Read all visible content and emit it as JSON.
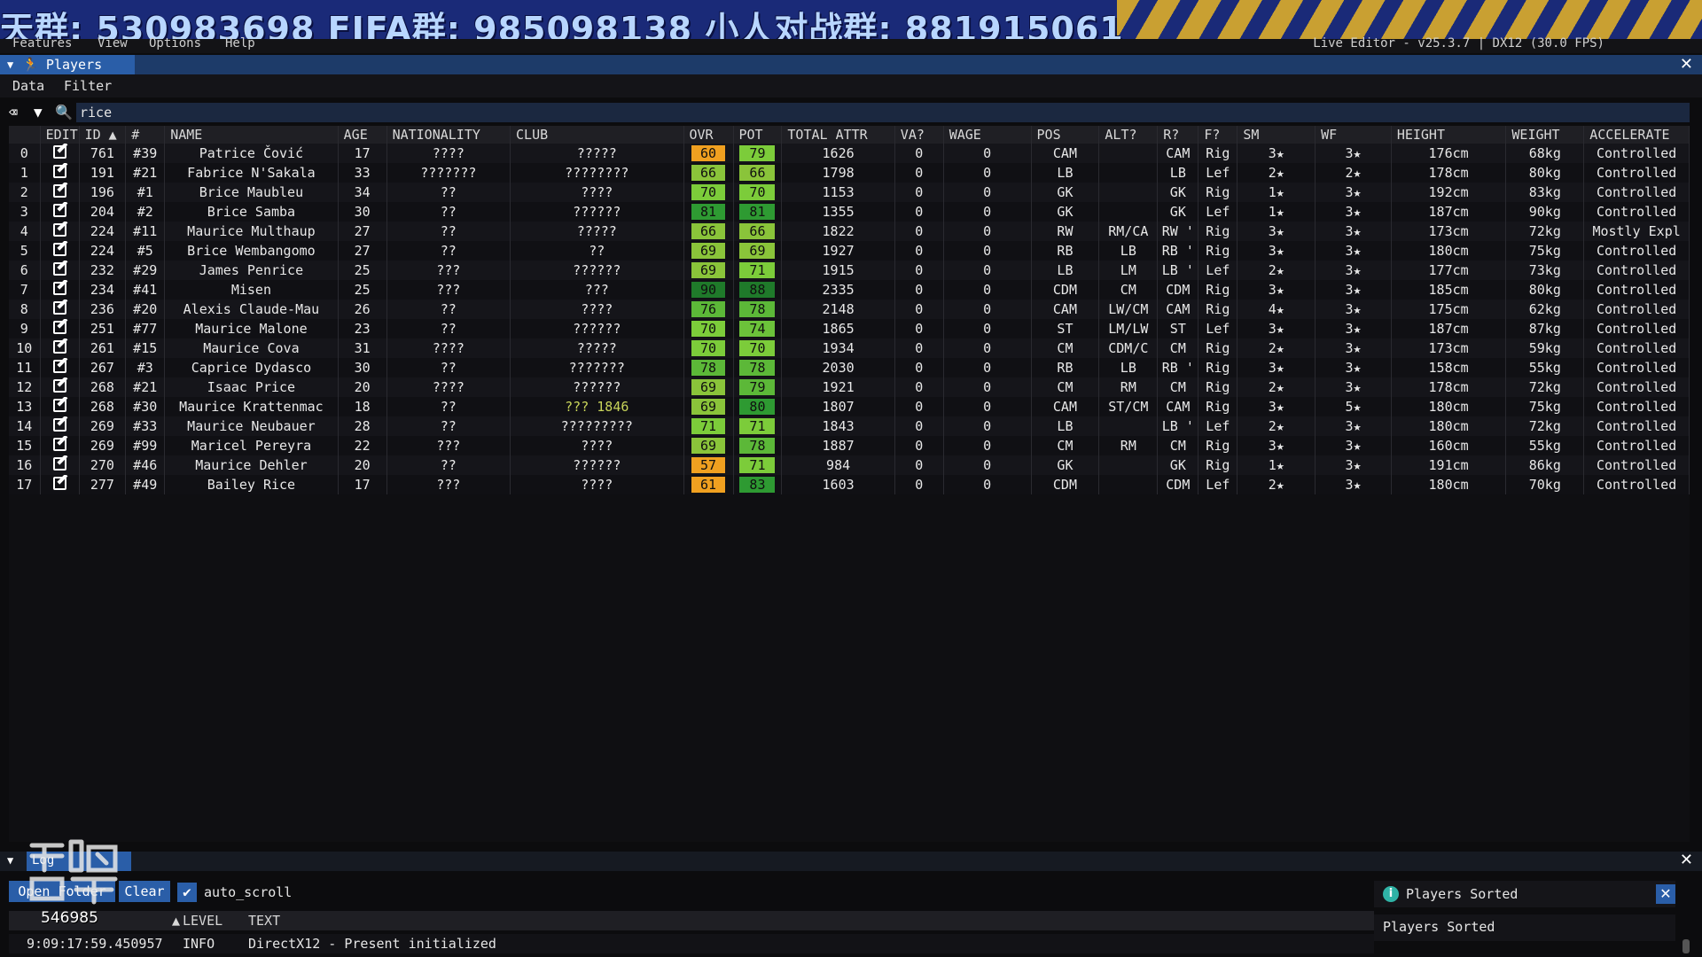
{
  "banner": {
    "text": "天群: 530983698   FIFA群: 985098138   小人对战群: 881915061"
  },
  "menubar": {
    "items": [
      "Features",
      "View",
      "Options",
      "Help"
    ],
    "editor_title": "Live Editor - v25.3.7 | DX12 (30.0 FPS)"
  },
  "players_window": {
    "tab_label": "Players",
    "menu": [
      "Data",
      "Filter"
    ],
    "search_value": "rice"
  },
  "table": {
    "columns": [
      "",
      "EDIT",
      "ID ▲",
      "#",
      "NAME",
      "AGE",
      "NATIONALITY",
      "CLUB",
      "OVR",
      "POT",
      "TOTAL ATTR",
      "VA?",
      "WAGE",
      "POS",
      "ALT?",
      "R?",
      "F?",
      "SM",
      "WF",
      "HEIGHT",
      "WEIGHT",
      "ACCELERATE"
    ],
    "rows": [
      {
        "idx": "0",
        "id": "761",
        "num": "#39",
        "name": "Patrice Čović",
        "age": "17",
        "nat": "????",
        "club": "?????",
        "ovr": "60",
        "pot": "79",
        "total": "1626",
        "va": "0",
        "wage": "0",
        "pos": "CAM",
        "alt": "",
        "r": "CAM",
        "f": "Rig",
        "sm": "3★",
        "wf": "3★",
        "height": "176cm",
        "weight": "68kg",
        "acc": "Controlled",
        "ovr_color": "#f0a020",
        "pot_color": "#7ccc3a"
      },
      {
        "idx": "1",
        "id": "191",
        "num": "#21",
        "name": "Fabrice N'Sakala",
        "age": "33",
        "nat": "???????",
        "club": "????????",
        "ovr": "66",
        "pot": "66",
        "total": "1798",
        "va": "0",
        "wage": "0",
        "pos": "LB",
        "alt": "",
        "r": "LB",
        "f": "Lef",
        "sm": "2★",
        "wf": "2★",
        "height": "178cm",
        "weight": "80kg",
        "acc": "Controlled",
        "ovr_color": "#8ac43a",
        "pot_color": "#8ac43a"
      },
      {
        "idx": "2",
        "id": "196",
        "num": "#1",
        "name": "Brice Maubleu",
        "age": "34",
        "nat": "??",
        "club": "????",
        "ovr": "70",
        "pot": "70",
        "total": "1153",
        "va": "0",
        "wage": "0",
        "pos": "GK",
        "alt": "",
        "r": "GK",
        "f": "Rig",
        "sm": "1★",
        "wf": "3★",
        "height": "192cm",
        "weight": "83kg",
        "acc": "Controlled",
        "ovr_color": "#7ccc3a",
        "pot_color": "#7ccc3a"
      },
      {
        "idx": "3",
        "id": "204",
        "num": "#2",
        "name": "Brice Samba",
        "age": "30",
        "nat": "??",
        "club": "??????",
        "ovr": "81",
        "pot": "81",
        "total": "1355",
        "va": "0",
        "wage": "0",
        "pos": "GK",
        "alt": "",
        "r": "GK",
        "f": "Lef",
        "sm": "1★",
        "wf": "3★",
        "height": "187cm",
        "weight": "90kg",
        "acc": "Controlled",
        "ovr_color": "#2e9a32",
        "pot_color": "#2e9a32"
      },
      {
        "idx": "4",
        "id": "224",
        "num": "#11",
        "name": "Maurice Multhaup",
        "age": "27",
        "nat": "??",
        "club": "?????",
        "ovr": "66",
        "pot": "66",
        "total": "1822",
        "va": "0",
        "wage": "0",
        "pos": "RW",
        "alt": "RM/CA",
        "r": "RW '",
        "f": "Rig",
        "sm": "3★",
        "wf": "3★",
        "height": "173cm",
        "weight": "72kg",
        "acc": "Mostly Expl",
        "ovr_color": "#8ac43a",
        "pot_color": "#8ac43a"
      },
      {
        "idx": "5",
        "id": "224",
        "num": "#5",
        "name": "Brice Wembangomo",
        "age": "27",
        "nat": "??",
        "club": "??",
        "ovr": "69",
        "pot": "69",
        "total": "1927",
        "va": "0",
        "wage": "0",
        "pos": "RB",
        "alt": "LB",
        "r": "RB '",
        "f": "Rig",
        "sm": "3★",
        "wf": "3★",
        "height": "180cm",
        "weight": "75kg",
        "acc": "Controlled",
        "ovr_color": "#8ac43a",
        "pot_color": "#8ac43a"
      },
      {
        "idx": "6",
        "id": "232",
        "num": "#29",
        "name": "James Penrice",
        "age": "25",
        "nat": "???",
        "club": "??????",
        "ovr": "69",
        "pot": "71",
        "total": "1915",
        "va": "0",
        "wage": "0",
        "pos": "LB",
        "alt": "LM",
        "r": "LB '",
        "f": "Lef",
        "sm": "2★",
        "wf": "3★",
        "height": "177cm",
        "weight": "73kg",
        "acc": "Controlled",
        "ovr_color": "#8ac43a",
        "pot_color": "#7ccc3a"
      },
      {
        "idx": "7",
        "id": "234",
        "num": "#41",
        "name": "Misen",
        "age": "25",
        "nat": "???",
        "club": "???",
        "ovr": "90",
        "pot": "88",
        "total": "2335",
        "va": "0",
        "wage": "0",
        "pos": "CDM",
        "alt": "CM",
        "r": "CDM",
        "f": "Rig",
        "sm": "3★",
        "wf": "3★",
        "height": "185cm",
        "weight": "80kg",
        "acc": "Controlled",
        "ovr_color": "#1f7a2a",
        "pot_color": "#1f7a2a"
      },
      {
        "idx": "8",
        "id": "236",
        "num": "#20",
        "name": "Alexis Claude-Mau",
        "age": "26",
        "nat": "??",
        "club": "????",
        "ovr": "76",
        "pot": "78",
        "total": "2148",
        "va": "0",
        "wage": "0",
        "pos": "CAM",
        "alt": "LW/CM",
        "r": "CAM",
        "f": "Rig",
        "sm": "4★",
        "wf": "3★",
        "height": "175cm",
        "weight": "62kg",
        "acc": "Controlled",
        "ovr_color": "#5cb838",
        "pot_color": "#5cb838"
      },
      {
        "idx": "9",
        "id": "251",
        "num": "#77",
        "name": "Maurice Malone",
        "age": "23",
        "nat": "??",
        "club": "??????",
        "ovr": "70",
        "pot": "74",
        "total": "1865",
        "va": "0",
        "wage": "0",
        "pos": "ST",
        "alt": "LM/LW",
        "r": "ST",
        "f": "Lef",
        "sm": "3★",
        "wf": "3★",
        "height": "187cm",
        "weight": "87kg",
        "acc": "Controlled",
        "ovr_color": "#7ccc3a",
        "pot_color": "#6cc23a"
      },
      {
        "idx": "10",
        "id": "261",
        "num": "#15",
        "name": "Maurice Cova",
        "age": "31",
        "nat": "????",
        "club": "?????",
        "ovr": "70",
        "pot": "70",
        "total": "1934",
        "va": "0",
        "wage": "0",
        "pos": "CM",
        "alt": "CDM/C",
        "r": "CM",
        "f": "Rig",
        "sm": "2★",
        "wf": "3★",
        "height": "173cm",
        "weight": "59kg",
        "acc": "Controlled",
        "ovr_color": "#7ccc3a",
        "pot_color": "#7ccc3a"
      },
      {
        "idx": "11",
        "id": "267",
        "num": "#3",
        "name": "Caprice Dydasco",
        "age": "30",
        "nat": "??",
        "club": "???????",
        "ovr": "78",
        "pot": "78",
        "total": "2030",
        "va": "0",
        "wage": "0",
        "pos": "RB",
        "alt": "LB",
        "r": "RB '",
        "f": "Rig",
        "sm": "3★",
        "wf": "3★",
        "height": "158cm",
        "weight": "55kg",
        "acc": "Controlled",
        "ovr_color": "#5cb838",
        "pot_color": "#5cb838"
      },
      {
        "idx": "12",
        "id": "268",
        "num": "#21",
        "name": "Isaac Price",
        "age": "20",
        "nat": "????",
        "club": "??????",
        "ovr": "69",
        "pot": "79",
        "total": "1921",
        "va": "0",
        "wage": "0",
        "pos": "CM",
        "alt": "RM",
        "r": "CM",
        "f": "Rig",
        "sm": "2★",
        "wf": "3★",
        "height": "178cm",
        "weight": "72kg",
        "acc": "Controlled",
        "ovr_color": "#8ac43a",
        "pot_color": "#5cb838"
      },
      {
        "idx": "13",
        "id": "268",
        "num": "#30",
        "name": "Maurice Krattenmac",
        "age": "18",
        "nat": "??",
        "club": "??? 1846",
        "ovr": "69",
        "pot": "80",
        "total": "1807",
        "va": "0",
        "wage": "0",
        "pos": "CAM",
        "alt": "ST/CM",
        "r": "CAM",
        "f": "Rig",
        "sm": "3★",
        "wf": "5★",
        "height": "180cm",
        "weight": "75kg",
        "acc": "Controlled",
        "ovr_color": "#8ac43a",
        "pot_color": "#2e9a32",
        "club_special": true
      },
      {
        "idx": "14",
        "id": "269",
        "num": "#33",
        "name": "Maurice Neubauer",
        "age": "28",
        "nat": "??",
        "club": "?????????",
        "ovr": "71",
        "pot": "71",
        "total": "1843",
        "va": "0",
        "wage": "0",
        "pos": "LB",
        "alt": "",
        "r": "LB '",
        "f": "Lef",
        "sm": "2★",
        "wf": "3★",
        "height": "180cm",
        "weight": "72kg",
        "acc": "Controlled",
        "ovr_color": "#7ccc3a",
        "pot_color": "#7ccc3a"
      },
      {
        "idx": "15",
        "id": "269",
        "num": "#99",
        "name": "Maricel Pereyra",
        "age": "22",
        "nat": "???",
        "club": "????",
        "ovr": "69",
        "pot": "78",
        "total": "1887",
        "va": "0",
        "wage": "0",
        "pos": "CM",
        "alt": "RM",
        "r": "CM",
        "f": "Rig",
        "sm": "3★",
        "wf": "3★",
        "height": "160cm",
        "weight": "55kg",
        "acc": "Controlled",
        "ovr_color": "#8ac43a",
        "pot_color": "#5cb838"
      },
      {
        "idx": "16",
        "id": "270",
        "num": "#46",
        "name": "Maurice Dehler",
        "age": "20",
        "nat": "??",
        "club": "??????",
        "ovr": "57",
        "pot": "71",
        "total": "984",
        "va": "0",
        "wage": "0",
        "pos": "GK",
        "alt": "",
        "r": "GK",
        "f": "Rig",
        "sm": "1★",
        "wf": "3★",
        "height": "191cm",
        "weight": "86kg",
        "acc": "Controlled",
        "ovr_color": "#f0a020",
        "pot_color": "#7ccc3a"
      },
      {
        "idx": "17",
        "id": "277",
        "num": "#49",
        "name": "Bailey Rice",
        "age": "17",
        "nat": "???",
        "club": "????",
        "ovr": "61",
        "pot": "83",
        "total": "1603",
        "va": "0",
        "wage": "0",
        "pos": "CDM",
        "alt": "",
        "r": "CDM",
        "f": "Lef",
        "sm": "2★",
        "wf": "3★",
        "height": "180cm",
        "weight": "70kg",
        "acc": "Controlled",
        "ovr_color": "#f0a020",
        "pot_color": "#2e9a32"
      }
    ]
  },
  "log_window": {
    "tab_label": "Log",
    "buttons": {
      "open_folder": "Open Folder",
      "clear": "Clear"
    },
    "auto_scroll_label": "auto_scroll",
    "columns": {
      "time": "9:09:17:59.450957",
      "level_header": "LEVEL",
      "text_header": "TEXT"
    },
    "row": {
      "time": "9:09:17:59.450957",
      "level": "INFO",
      "text": "DirectX12 - Present initialized"
    }
  },
  "notifications": {
    "toast_title": "Players Sorted",
    "toast_body": "Players Sorted"
  },
  "watermark": {
    "number": "546985"
  }
}
